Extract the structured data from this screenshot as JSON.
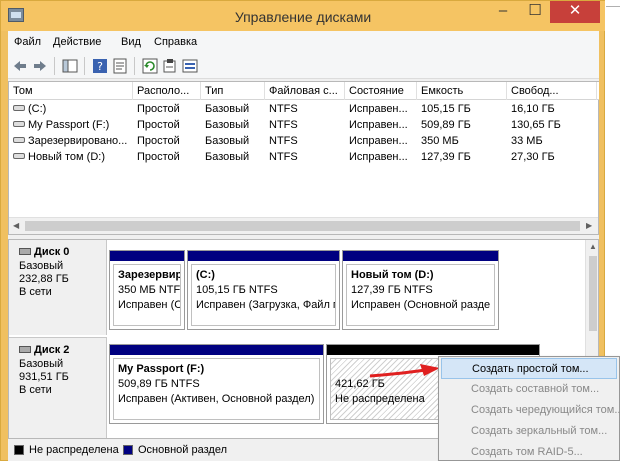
{
  "window": {
    "title": "Управление дисками",
    "minimize": "–",
    "maximize": "☐",
    "close": "✕"
  },
  "menu": [
    "Файл",
    "Действие",
    "Вид",
    "Справка"
  ],
  "toolbar_icons": [
    "back-arrow-icon",
    "forward-arrow-icon",
    "console-tree-icon",
    "help-icon",
    "properties-icon",
    "refresh-icon",
    "rescan-icon",
    "view-icon"
  ],
  "volume_list": {
    "columns": [
      "Том",
      "Располо...",
      "Тип",
      "Файловая с...",
      "Состояние",
      "Емкость",
      "Свобод..."
    ],
    "rows": [
      [
        "(C:)",
        "Простой",
        "Базовый",
        "NTFS",
        "Исправен...",
        "105,15 ГБ",
        "16,10 ГБ"
      ],
      [
        "My Passport (F:)",
        "Простой",
        "Базовый",
        "NTFS",
        "Исправен...",
        "509,89 ГБ",
        "130,65 ГБ"
      ],
      [
        "Зарезервировано...",
        "Простой",
        "Базовый",
        "NTFS",
        "Исправен...",
        "350 МБ",
        "33 МБ"
      ],
      [
        "Новый том (D:)",
        "Простой",
        "Базовый",
        "NTFS",
        "Исправен...",
        "127,39 ГБ",
        "27,30 ГБ"
      ]
    ]
  },
  "disks": [
    {
      "name": "Диск 0",
      "type": "Базовый",
      "size": "232,88 ГБ",
      "status": "В сети",
      "partitions": [
        {
          "title": "Зарезервир",
          "line2": "350 МБ NTFS",
          "line3": "Исправен (С"
        },
        {
          "title": "(C:)",
          "line2": "105,15 ГБ NTFS",
          "line3": "Исправен (Загрузка, Файл п"
        },
        {
          "title": "Новый том  (D:)",
          "line2": "127,39 ГБ NTFS",
          "line3": "Исправен (Основной разде"
        }
      ]
    },
    {
      "name": "Диск 2",
      "type": "Базовый",
      "size": "931,51 ГБ",
      "status": "В сети",
      "partitions": [
        {
          "title": "My Passport  (F:)",
          "line2": "509,89 ГБ NTFS",
          "line3": "Исправен (Активен, Основной раздел)"
        },
        {
          "title": "",
          "line2": "421,62 ГБ",
          "line3": "Не распределена"
        }
      ]
    }
  ],
  "legend": [
    {
      "label": "Не распределена",
      "color": "#000000"
    },
    {
      "label": "Основной раздел",
      "color": "#000080"
    }
  ],
  "context_menu": [
    {
      "label": "Создать простой том...",
      "enabled": true
    },
    {
      "label": "Создать составной том...",
      "enabled": false
    },
    {
      "label": "Создать чередующийся том...",
      "enabled": false
    },
    {
      "label": "Создать зеркальный том...",
      "enabled": false
    },
    {
      "label": "Создать том RAID-5...",
      "enabled": false
    }
  ],
  "colors": {
    "accent": "#f5c463",
    "primary_partition": "#000080",
    "unallocated": "#000000",
    "arrow": "#e02020"
  }
}
